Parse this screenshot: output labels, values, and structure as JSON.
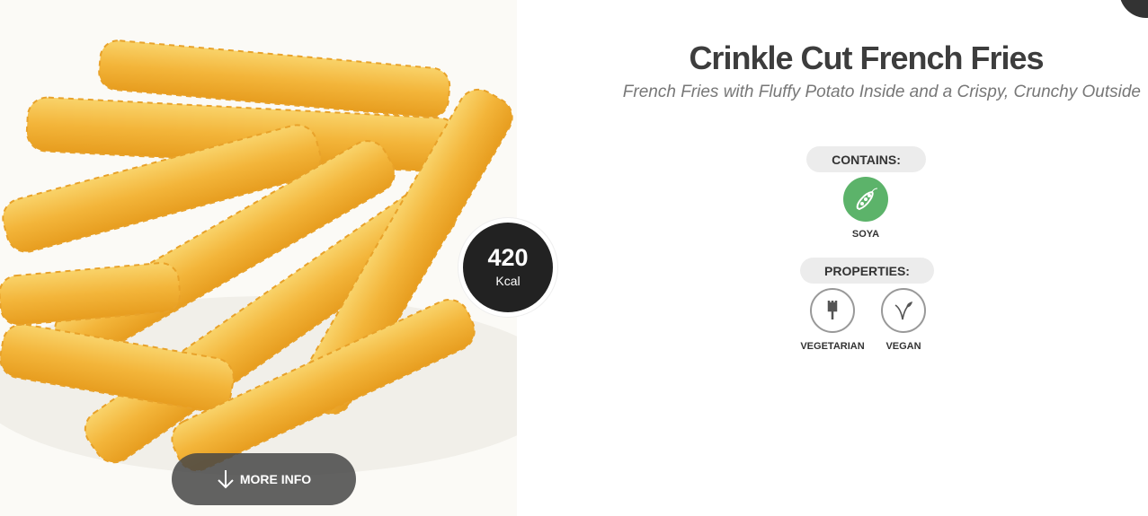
{
  "product": {
    "title": "Crinkle Cut French Fries",
    "subtitle": "French Fries with Fluffy Potato Inside and a Crispy, Crunchy Outside"
  },
  "energy": {
    "value": "420",
    "unit": "Kcal"
  },
  "more_info": {
    "label": "MORE INFO",
    "icon": "arrow-down-icon"
  },
  "contains": {
    "heading": "CONTAINS:",
    "items": [
      {
        "label": "SOYA",
        "icon": "soya-icon",
        "color": "#5cb36a"
      }
    ]
  },
  "properties": {
    "heading": "PROPERTIES:",
    "items": [
      {
        "label": "VEGETARIAN",
        "icon": "vegetarian-fork-icon"
      },
      {
        "label": "VEGAN",
        "icon": "vegan-leaf-icon"
      }
    ]
  }
}
